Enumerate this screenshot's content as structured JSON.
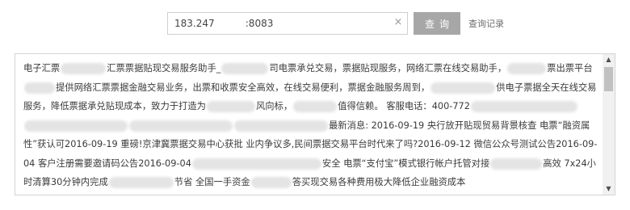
{
  "search": {
    "value": "183.247          :8083",
    "clear_glyph": "×"
  },
  "buttons": {
    "query_label": "查询",
    "history_label": "查询记录"
  },
  "content": {
    "segments": [
      "电子汇票",
      "汇票票据贴现交易服务助手_",
      "司电票承兑交易，票据贴现服务，网络汇票在线交易助手，",
      "票出票平台",
      "提供网络汇票票据金融交易业务，出票和收票安全高效，在线交易便利，票据金融服务周到，",
      "供电子票据全天在线交易服务，降低票据承兑贴现成本，致力于打造为",
      "风向标，",
      "值得信赖。 客服电话：400-772",
      "最新消息: 2016-09-19 央行放开贴现贸易背景核查 电票“融资属性”获认可2016-09-19 重磅!京津冀票据交易中心获批 业内争议多,民间票据交易平台时代来了吗?2016-09-12 微信公众号测试公告2016-09-04 客户注册需要邀请码公告2016-09-04",
      "安全 电票“支付宝”模式银行帐户托管对接",
      "高效 7x24小时清算30分钟内完成",
      "节省 全国一手资金",
      "答买现交易各种费用极大降低企业融资成本"
    ]
  },
  "icons": {
    "scroll_up": "▲",
    "scroll_down": "▼"
  }
}
